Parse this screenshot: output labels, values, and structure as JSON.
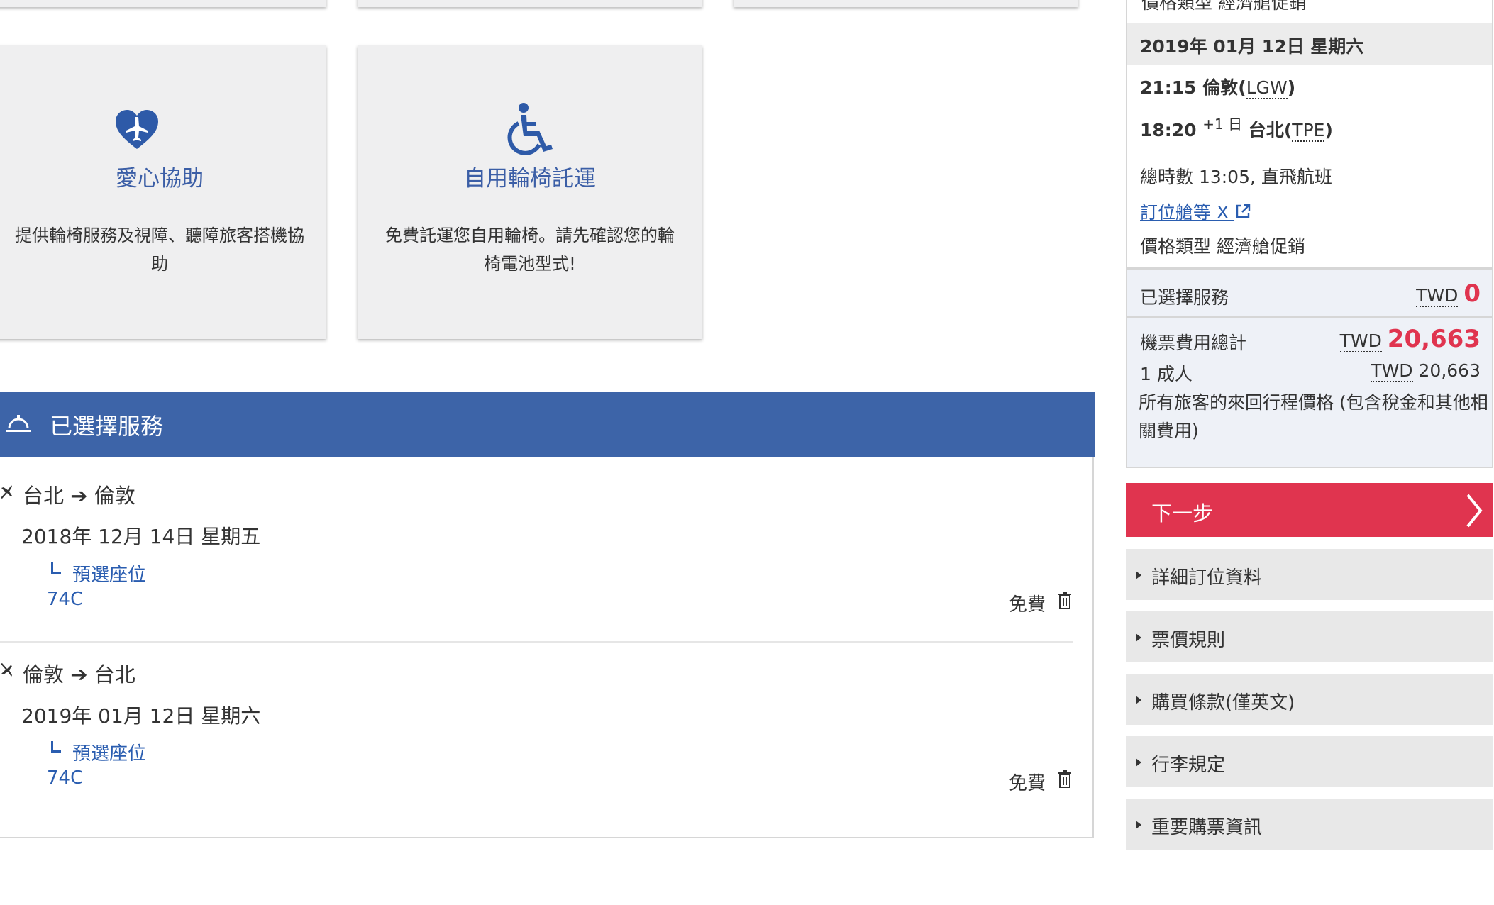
{
  "cards": [
    {
      "title": "愛心協助",
      "desc_line1": "提供輪椅服務及視障、聽障旅客搭機協",
      "desc_line2": "助",
      "icon": "heart-plane-icon"
    },
    {
      "title": "自用輪椅託運",
      "desc_line1": "免費託運您自用輪椅。請先確認您的輪",
      "desc_line2": "椅電池型式!",
      "icon": "wheelchair-icon"
    }
  ],
  "selected_services": {
    "title": "已選擇服務",
    "icon": "service-bell-icon",
    "segments": [
      {
        "from": "台北",
        "to": "倫敦",
        "date": "2018年 12月 14日 星期五",
        "seat_label": "預選座位",
        "seat": "74C",
        "price": "免費"
      },
      {
        "from": "倫敦",
        "to": "台北",
        "date": "2019年 01月 12日 星期六",
        "seat_label": "預選座位",
        "seat": "74C",
        "price": "免費"
      }
    ]
  },
  "sidebar": {
    "top_cut_text": "價格類型 經濟艙促銷",
    "date_header": "2019年 01月 12日 星期六",
    "dep_time": "21:15",
    "dep_city": "倫敦(",
    "dep_code": "LGW",
    "dep_close": ")",
    "arr_time": "18:20",
    "arr_day_offset": "+1 日",
    "arr_city": "台北(",
    "arr_code": "TPE",
    "arr_close": ")",
    "duration": "總時數 13:05, 直飛航班",
    "booking_class_link": "訂位艙等 X",
    "fare_type": "價格類型 經濟艙促銷",
    "selected_services_label": "已選擇服務",
    "selected_services_currency": "TWD",
    "selected_services_amount": "0",
    "ticket_total_label": "機票費用總計",
    "ticket_total_currency": "TWD",
    "ticket_total_amount": "20,663",
    "passenger_label": "1 成人",
    "passenger_currency": "TWD",
    "passenger_amount": "20,663",
    "note_line1": "所有旅客的來回行程價格 (包含稅金和其他相",
    "note_line2": "關費用)",
    "next_button": "下一步",
    "accordions": [
      "詳細訂位資料",
      "票價規則",
      "購買條款(僅英文)",
      "行李規定",
      "重要購票資訊"
    ]
  },
  "colors": {
    "primary_blue": "#3d64a8",
    "link_blue": "#2a5db0",
    "accent_red": "#e0344f"
  }
}
